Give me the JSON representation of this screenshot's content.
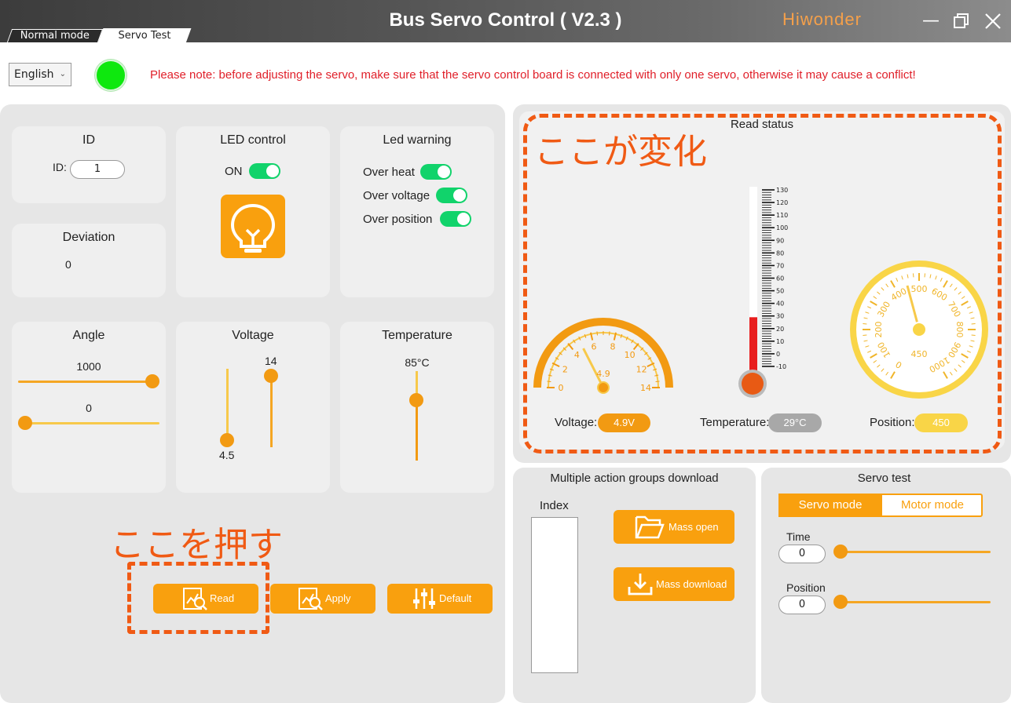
{
  "window": {
    "title": "Bus Servo Control ( V2.3 )",
    "logo": "Hiwonder",
    "tabs": [
      "Normal mode",
      "Servo Test"
    ]
  },
  "top": {
    "language": "English",
    "notice": "Please note: before adjusting the servo, make sure that the servo control board is connected with only one servo, otherwise it may cause a conflict!"
  },
  "id_card": {
    "title": "ID",
    "label": "ID:",
    "value": "1"
  },
  "led_card": {
    "title": "LED control",
    "on_label": "ON"
  },
  "warning_card": {
    "title": "Led warning",
    "items": [
      "Over heat",
      "Over voltage",
      "Over position"
    ]
  },
  "deviation_card": {
    "title": "Deviation",
    "value": "0"
  },
  "angle_card": {
    "title": "Angle",
    "max_value": "1000",
    "min_value": "0"
  },
  "voltage_card": {
    "title": "Voltage",
    "low_value": "4.5",
    "high_value": "14"
  },
  "temperature_card": {
    "title": "Temperature",
    "value": "85°C"
  },
  "buttons": {
    "read": "Read",
    "apply": "Apply",
    "default": "Default"
  },
  "annotations": {
    "read_status_change": "ここが変化",
    "press_here": "ここを押す"
  },
  "read_status": {
    "title": "Read status",
    "voltage_label": "Voltage:",
    "voltage_value": "4.9V",
    "temperature_label": "Temperature:",
    "temperature_value": "29°C",
    "position_label": "Position:",
    "position_value": "450",
    "voltage_gauge_ticks": [
      "0",
      "2",
      "4",
      "6",
      "8",
      "10",
      "12",
      "14"
    ],
    "voltage_gauge_reading": "4.9",
    "thermo_ticks": [
      "130",
      "120",
      "110",
      "100",
      "90",
      "80",
      "70",
      "60",
      "50",
      "40",
      "30",
      "20",
      "10",
      "0",
      "-10"
    ],
    "position_gauge_ticks": [
      "0",
      "100",
      "200",
      "300",
      "400",
      "500",
      "600",
      "700",
      "800",
      "900",
      "1000"
    ],
    "position_gauge_reading": "450"
  },
  "download": {
    "title": "Multiple action groups download",
    "index_label": "Index",
    "mass_open": "Mass open",
    "mass_download": "Mass download"
  },
  "servo_test": {
    "title": "Servo test",
    "servo_mode": "Servo mode",
    "motor_mode": "Motor mode",
    "time_label": "Time",
    "time_value": "0",
    "position_label": "Position",
    "position_value": "0"
  },
  "colors": {
    "accent": "#f9a00e",
    "annotation": "#f05a14",
    "status_green": "#0ee80e",
    "notice_red": "#e0202a",
    "toggle_green": "#11d36b"
  }
}
